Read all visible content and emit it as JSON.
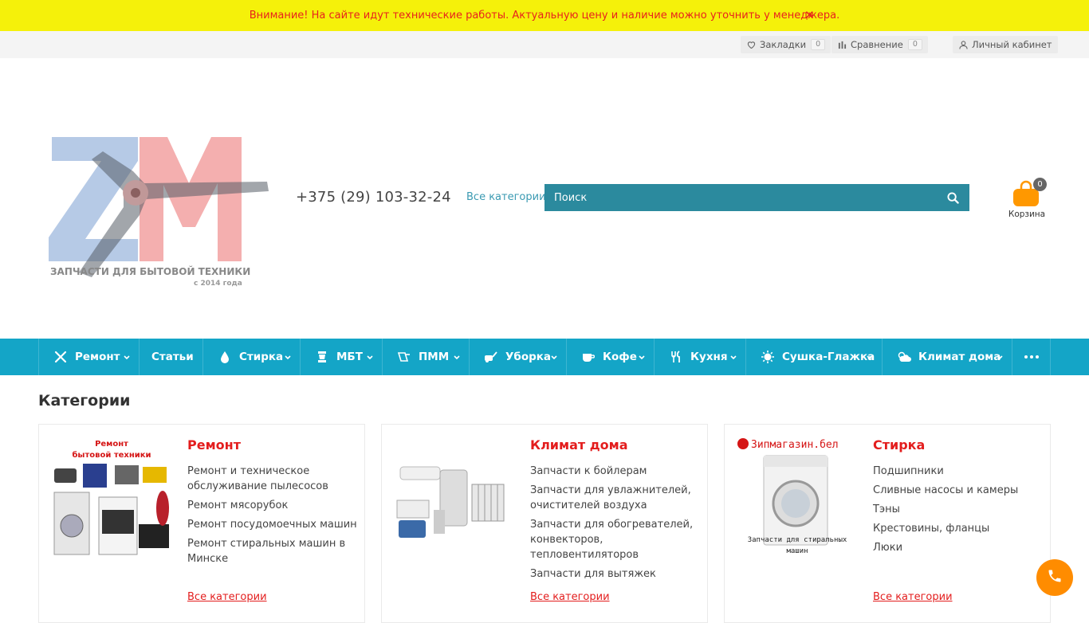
{
  "notice": {
    "text": "Внимание! На сайте идут технические работы. Актуальную цену и наличие можно уточнить у менеджера.",
    "close": "✕"
  },
  "topbar": {
    "bookmarks": {
      "label": "Закладки",
      "count": "0"
    },
    "compare": {
      "label": "Сравнение",
      "count": "0"
    },
    "account": {
      "label": "Личный кабинет"
    }
  },
  "logo": {
    "text_line1": "ЗАПЧАСТИ ДЛЯ БЫТОВОЙ ТЕХНИКИ",
    "text_line2": "с 2014 года"
  },
  "header": {
    "phone": "+375 (29) 103-32-24",
    "all_categories": "Все категории",
    "search_placeholder": "Поиск",
    "cart_count": "0",
    "cart_label": "Корзина"
  },
  "menu": [
    {
      "label": "Ремонт",
      "icon": "wrench-icon"
    },
    {
      "label": "Статьи",
      "icon": ""
    },
    {
      "label": "Стирка",
      "icon": "drop-icon"
    },
    {
      "label": "МБТ",
      "icon": "blender-icon"
    },
    {
      "label": "ПММ",
      "icon": "dishwasher-icon"
    },
    {
      "label": "Уборка",
      "icon": "vacuum-icon"
    },
    {
      "label": "Кофе",
      "icon": "coffee-icon"
    },
    {
      "label": "Кухня",
      "icon": "cutlery-icon"
    },
    {
      "label": "Сушка-Глажка",
      "icon": "sun-icon"
    },
    {
      "label": "Климат дома",
      "icon": "cloud-sun-icon"
    }
  ],
  "categories": {
    "title": "Категории",
    "cards": [
      {
        "title": "Ремонт",
        "image_caption": "Ремонт бытовой техники",
        "items": [
          "Ремонт и техническое обслуживание пылесосов",
          "Ремонт мясорубок",
          "Ремонт посудомоечных машин",
          "Ремонт стиральных машин в Минске"
        ],
        "all_link": "Все категории"
      },
      {
        "title": "Климат дома",
        "image_caption": "",
        "items": [
          "Запчасти к бойлерам",
          "Запчасти для увлажнителей, очистителей воздуха",
          "Запчасти для обогревателей, конвекторов, тепловентиляторов",
          "Запчасти для вытяжек"
        ],
        "all_link": "Все категории"
      },
      {
        "title": "Стирка",
        "image_caption_top": "Зипмагазин.бел",
        "image_caption": "Запчасти для стиральных машин",
        "items": [
          "Подшипники",
          "Сливные насосы и камеры",
          "Тэны",
          "Крестовины, фланцы",
          "Люки"
        ],
        "all_link": "Все категории"
      }
    ]
  },
  "colors": {
    "notice_bg": "#f5f10a",
    "notice_text": "#e8221d",
    "menu_bg": "#14a5c7",
    "search_bg": "#2b8a9e",
    "cart_orange": "#ff9800",
    "category_red": "#e31d1d"
  }
}
